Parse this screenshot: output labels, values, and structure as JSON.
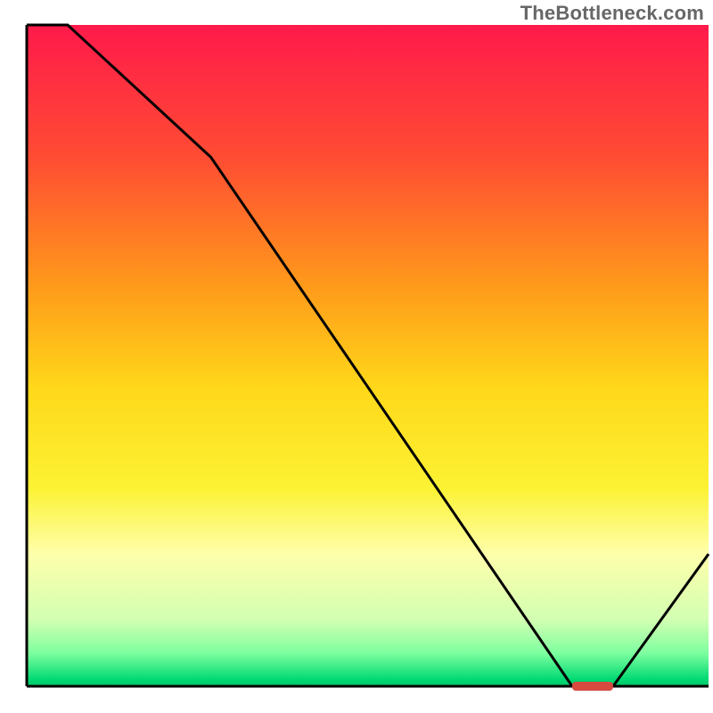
{
  "attribution": "TheBottleneck.com",
  "chart_data": {
    "type": "line",
    "title": "",
    "xlabel": "",
    "ylabel": "",
    "xlim": [
      0,
      100
    ],
    "ylim": [
      0,
      100
    ],
    "x": [
      0,
      6,
      27,
      80,
      86,
      100
    ],
    "values": [
      100,
      100,
      80,
      0,
      0,
      20
    ],
    "gradient_stops": [
      {
        "offset": 0,
        "color": "#ff1a4b"
      },
      {
        "offset": 20,
        "color": "#ff4c33"
      },
      {
        "offset": 40,
        "color": "#ff9c1a"
      },
      {
        "offset": 55,
        "color": "#ffd81a"
      },
      {
        "offset": 70,
        "color": "#fcf233"
      },
      {
        "offset": 80,
        "color": "#feffab"
      },
      {
        "offset": 90,
        "color": "#d2ffb2"
      },
      {
        "offset": 95,
        "color": "#7dff9f"
      },
      {
        "offset": 99,
        "color": "#00d973"
      },
      {
        "offset": 100,
        "color": "#00c365"
      }
    ],
    "marker": {
      "x_start": 80,
      "x_end": 86,
      "y": 0,
      "color": "#d84a3f"
    },
    "axis_color": "#000000",
    "line_color": "#000000"
  }
}
